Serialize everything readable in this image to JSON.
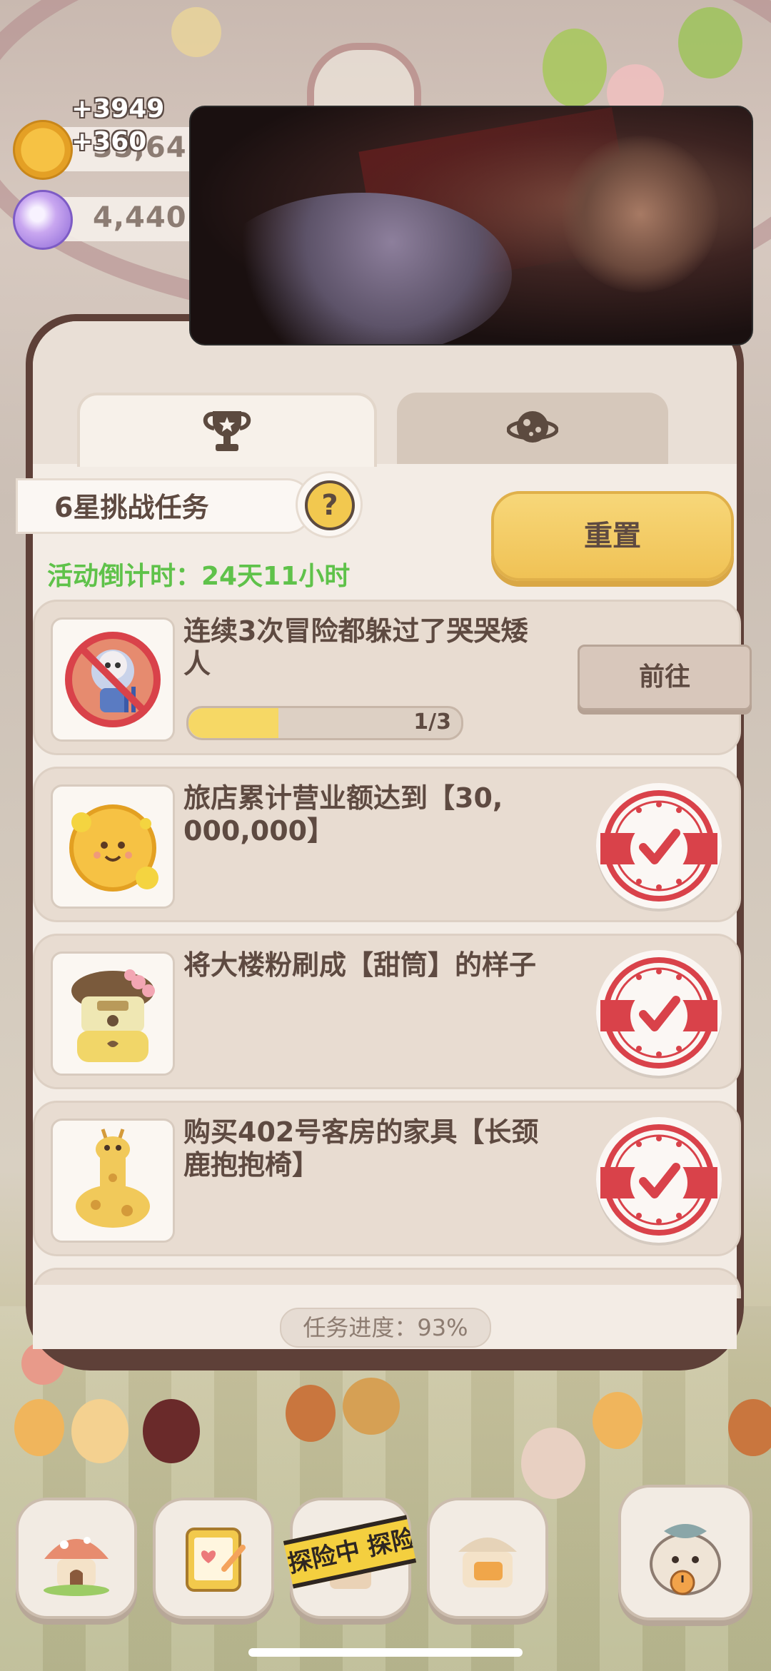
{
  "currency": {
    "coins": {
      "icon": "cookie-coin-icon",
      "value_partial": "35,64",
      "float_top": "+3949",
      "float_bottom": "+360"
    },
    "gems": {
      "icon": "purple-gem-icon",
      "value": "4,440"
    }
  },
  "tabs": [
    {
      "icon": "trophy-icon",
      "active": true
    },
    {
      "icon": "planet-icon",
      "active": false
    }
  ],
  "challenge": {
    "title": "6星挑战任务",
    "help_symbol": "?",
    "countdown": "活动倒计时：24天11小时",
    "reset_label": "重置"
  },
  "tasks": [
    {
      "icon": "no-crying-dwarf-icon",
      "description": "连续3次冒险都躲过了哭哭矮人",
      "progress_text": "1/3",
      "progress": 0.333,
      "action_label": "前往",
      "completed": false
    },
    {
      "icon": "gold-cookie-icon",
      "description": "旅店累计营业额达到【30,000,000】",
      "completed": true
    },
    {
      "icon": "cone-hotel-icon",
      "description": "将大楼粉刷成【甜筒】的样子",
      "completed": true
    },
    {
      "icon": "giraffe-chair-icon",
      "description": "购买402号客房的家具【长颈鹿抱抱椅】",
      "completed": true
    }
  ],
  "overall_progress": "任务进度：93%",
  "bottom_nav": {
    "items": [
      "mushroom-house-icon",
      "notebook-icon",
      "adventure-icon",
      "shop-counter-icon",
      "fish-pet-icon"
    ],
    "adventure_tape": "探险中 探险"
  },
  "colors": {
    "accent_yellow": "#f0c255",
    "countdown_green": "#5fc24a",
    "stamp_red": "#d9424a",
    "panel_border": "#5e4038"
  }
}
